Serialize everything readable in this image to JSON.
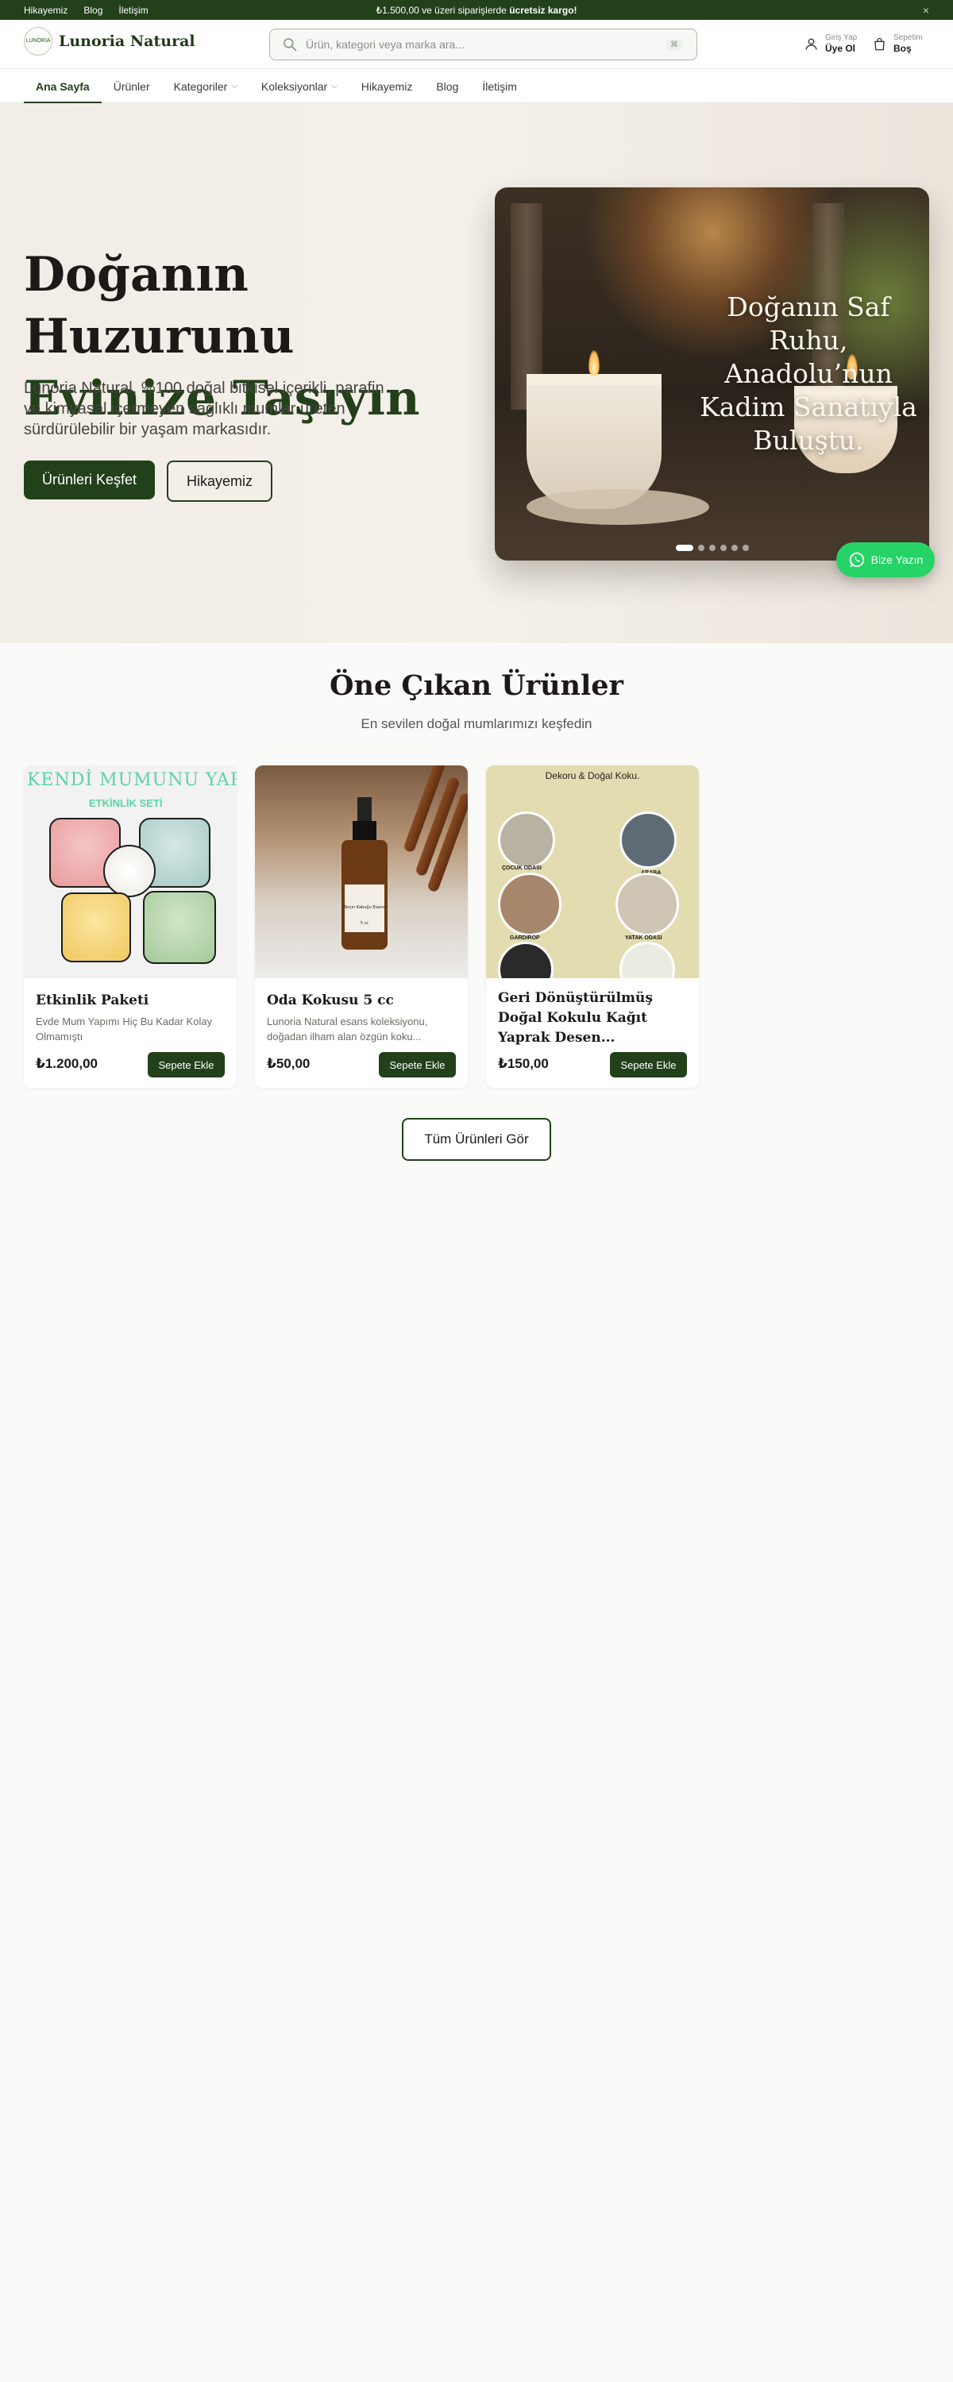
{
  "topbar": {
    "links": [
      "Hikayemiz",
      "Blog",
      "İletişim"
    ],
    "promo_prefix": "₺1.500,00 ve üzeri siparişlerde",
    "promo_bold": "ücretsiz kargo!",
    "close_symbol": "×"
  },
  "header": {
    "logo_mark": "LUNORIA",
    "logo_name": "Lunoria Natural",
    "search_placeholder": "Ürün, kategori veya marka ara...",
    "search_shortcut": "⌘",
    "account_small": "Giriş Yap",
    "account_main": "Üye Ol",
    "cart_small": "Sepetim",
    "cart_main": "Boş"
  },
  "nav": {
    "items": [
      {
        "label": "Ana Sayfa"
      },
      {
        "label": "Ürünler"
      },
      {
        "label": "Kategoriler"
      },
      {
        "label": "Koleksiyonlar"
      },
      {
        "label": "Hikayemiz"
      },
      {
        "label": "Blog"
      },
      {
        "label": "İletişim"
      }
    ],
    "active_index": 0
  },
  "hero": {
    "title_line1": "Doğanın Huzurunu",
    "title_line2": "Evinize Taşıyın",
    "description": "Lunoria Natural, %100 doğal bitkisel içerikli, parafin ve kimyasal içermeyen sağlıklı mumlar üreten sürdürülebilir bir yaşam markasıdır.",
    "primary_button": "Ürünleri Keşfet",
    "secondary_button": "Hikayemiz",
    "slide_caption": "Doğanın Saf Ruhu, Anadolu’nun Kadim Sanatıyla Buluştu.",
    "slide_count": 6,
    "active_slide": 0
  },
  "whatsapp": {
    "label": "Bize Yazın"
  },
  "featured": {
    "title": "Öne Çıkan Ürünler",
    "subtitle": "En sevilen doğal mumlarımızı keşfedin",
    "products": [
      {
        "name": "Etkinlik Paketi",
        "description": "Evde Mum Yapımı Hiç Bu Kadar Kolay Olmamıştı",
        "price": "₺1.200,00",
        "button": "Sepete Ekle",
        "image_banner": "KENDİ MUMUNU YAP",
        "image_sub": "ETKİNLİK SETİ"
      },
      {
        "name": "Oda Kokusu 5 cc",
        "description": "Lunoria Natural esans koleksiyonu, doğadan ilham alan özgün koku...",
        "price": "₺50,00",
        "button": "Sepete Ekle",
        "image_label": "Tarçın Kabuğu Esansı",
        "image_volume": "5 cc"
      },
      {
        "name": "Geri Dönüştürülmüş Doğal Kokulu Kağıt Yaprak Desen...",
        "description": "",
        "price": "₺150,00",
        "button": "Sepete Ekle",
        "image_head": "Dekoru & Doğal Koku.",
        "image_labels": [
          "ÇOCUK ODASI",
          "ARABA",
          "GARDIROP",
          "YATAK ODASI"
        ]
      }
    ],
    "all_button": "Tüm Ürünleri Gör"
  },
  "colors": {
    "brand_green": "#22401a",
    "whatsapp_green": "#25d366",
    "page_bg": "#fafaf9"
  }
}
